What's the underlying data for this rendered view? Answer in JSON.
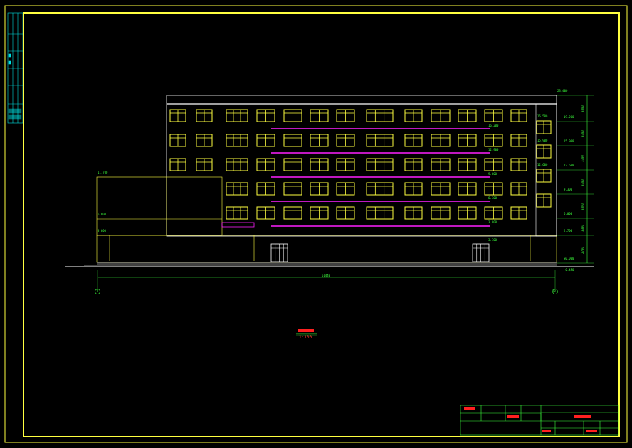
{
  "drawing": {
    "scale_text": "1:100",
    "total_width_dim": "61440",
    "grid_left": "1",
    "grid_right": "18",
    "elev_top": "23.400",
    "elev_levels_right": [
      "19.200",
      "15.900",
      "12.600",
      "9.300",
      "6.000",
      "2.700",
      "±0.000",
      "-0.450"
    ],
    "floor_dims": [
      "3300",
      "3300",
      "3300",
      "3300",
      "3300",
      "3300",
      "2700"
    ],
    "annex_elevs": [
      "11.700",
      "6.600",
      "3.600"
    ],
    "marks": [
      "16.200",
      "12.900",
      "9.600",
      "6.300",
      "3.000"
    ],
    "annex_small": [
      "16.500",
      "15.900",
      "12.600"
    ]
  },
  "colors": {
    "frame": "#ffff40",
    "green": "#3cff3c",
    "magenta": "#ff20ff",
    "white": "#ffffff",
    "cyan": "#00e0e0",
    "red": "#ff2020"
  }
}
